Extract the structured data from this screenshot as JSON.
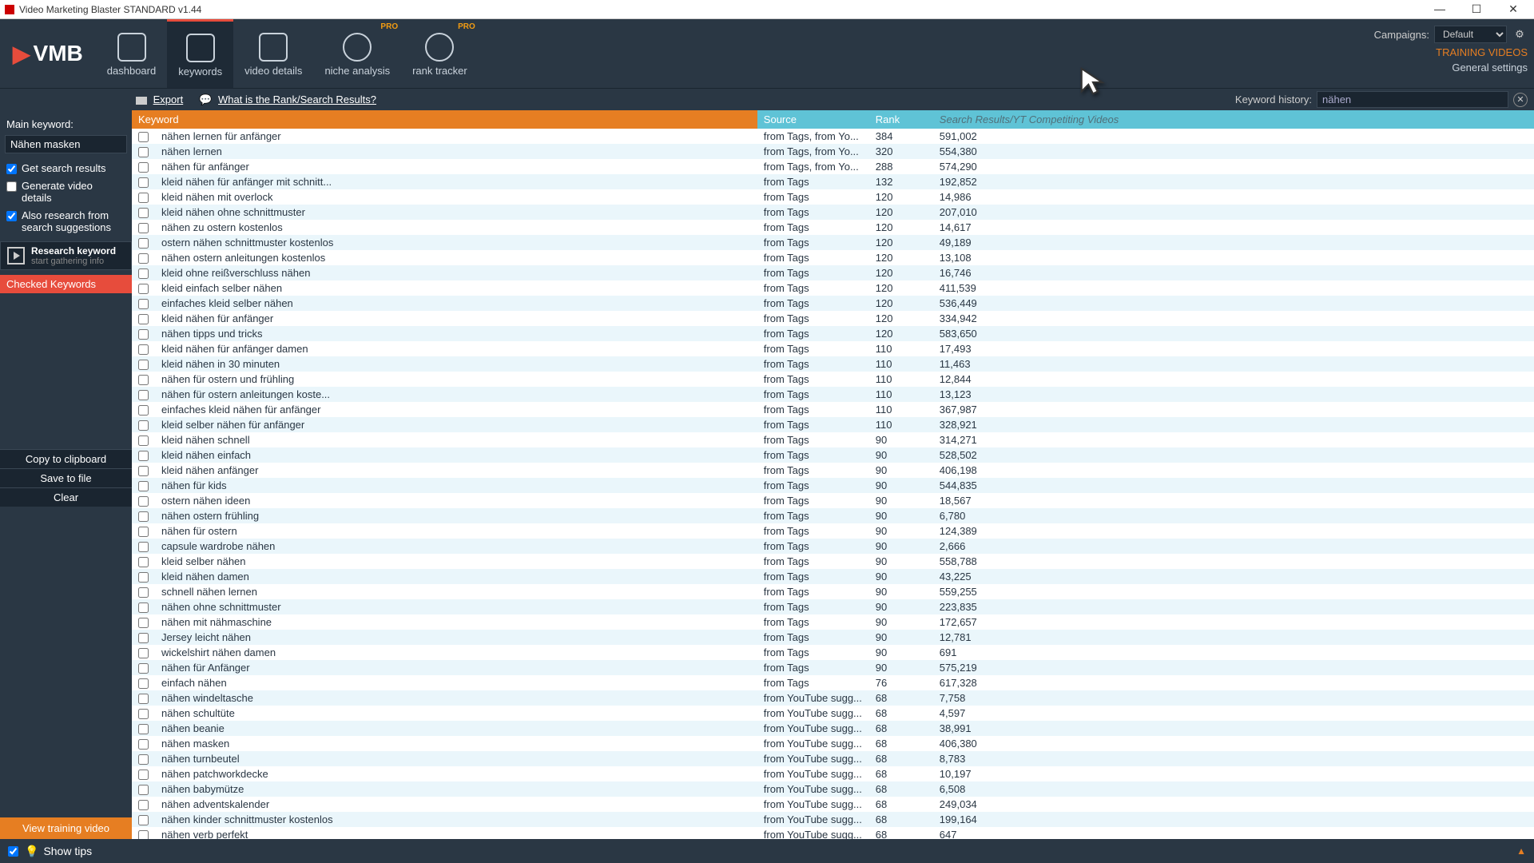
{
  "window": {
    "title": "Video Marketing Blaster STANDARD v1.44"
  },
  "logo": {
    "brand": "VMB"
  },
  "nav": {
    "tabs": [
      {
        "label": "dashboard"
      },
      {
        "label": "keywords"
      },
      {
        "label": "video details"
      },
      {
        "label": "niche analysis",
        "pro": "PRO"
      },
      {
        "label": "rank tracker",
        "pro": "PRO"
      }
    ]
  },
  "header_right": {
    "campaigns_label": "Campaigns:",
    "campaigns_value": "Default",
    "training": "TRAINING VIDEOS",
    "settings": "General settings"
  },
  "toolbar": {
    "export": "Export",
    "help": "What is the Rank/Search Results?",
    "history_label": "Keyword history:",
    "history_value": "nähen"
  },
  "sidebar": {
    "main_kw_label": "Main keyword:",
    "main_kw_value": "Nähen masken",
    "get_search": "Get search results",
    "gen_details": "Generate video details",
    "also_research": "Also research from search suggestions",
    "research_t1": "Research keyword",
    "research_t2": "start gathering info",
    "checked": "Checked Keywords",
    "copy": "Copy to clipboard",
    "save": "Save to file",
    "clear": "Clear",
    "view_training": "View training video"
  },
  "columns": {
    "keyword": "Keyword",
    "source": "Source",
    "rank": "Rank",
    "results": "Search Results/YT Competiting Videos"
  },
  "rows": [
    {
      "kw": "nähen lernen für anfänger",
      "src": "from Tags, from Yo...",
      "rank": "384",
      "res": "591,002"
    },
    {
      "kw": "nähen lernen",
      "src": "from Tags, from Yo...",
      "rank": "320",
      "res": "554,380"
    },
    {
      "kw": "nähen für anfänger",
      "src": "from Tags, from Yo...",
      "rank": "288",
      "res": "574,290"
    },
    {
      "kw": "kleid nähen für anfänger mit schnitt...",
      "src": "from Tags",
      "rank": "132",
      "res": "192,852"
    },
    {
      "kw": "kleid nähen mit overlock",
      "src": "from Tags",
      "rank": "120",
      "res": "14,986"
    },
    {
      "kw": "kleid nähen ohne schnittmuster",
      "src": "from Tags",
      "rank": "120",
      "res": "207,010"
    },
    {
      "kw": "nähen zu ostern kostenlos",
      "src": "from Tags",
      "rank": "120",
      "res": "14,617"
    },
    {
      "kw": "ostern nähen schnittmuster kostenlos",
      "src": "from Tags",
      "rank": "120",
      "res": "49,189"
    },
    {
      "kw": "nähen ostern anleitungen kostenlos",
      "src": "from Tags",
      "rank": "120",
      "res": "13,108"
    },
    {
      "kw": "kleid ohne reißverschluss nähen",
      "src": "from Tags",
      "rank": "120",
      "res": "16,746"
    },
    {
      "kw": "kleid einfach selber nähen",
      "src": "from Tags",
      "rank": "120",
      "res": "411,539"
    },
    {
      "kw": "einfaches kleid selber nähen",
      "src": "from Tags",
      "rank": "120",
      "res": "536,449"
    },
    {
      "kw": "kleid nähen für anfänger",
      "src": "from Tags",
      "rank": "120",
      "res": "334,942"
    },
    {
      "kw": "nähen tipps und tricks",
      "src": "from Tags",
      "rank": "120",
      "res": "583,650"
    },
    {
      "kw": "kleid nähen für anfänger damen",
      "src": "from Tags",
      "rank": "110",
      "res": "17,493"
    },
    {
      "kw": "kleid nähen in 30 minuten",
      "src": "from Tags",
      "rank": "110",
      "res": "11,463"
    },
    {
      "kw": "nähen für ostern und frühling",
      "src": "from Tags",
      "rank": "110",
      "res": "12,844"
    },
    {
      "kw": "nähen für ostern anleitungen koste...",
      "src": "from Tags",
      "rank": "110",
      "res": "13,123"
    },
    {
      "kw": "einfaches kleid nähen für anfänger",
      "src": "from Tags",
      "rank": "110",
      "res": "367,987"
    },
    {
      "kw": "kleid selber nähen für anfänger",
      "src": "from Tags",
      "rank": "110",
      "res": "328,921"
    },
    {
      "kw": "kleid nähen schnell",
      "src": "from Tags",
      "rank": "90",
      "res": "314,271"
    },
    {
      "kw": "kleid nähen einfach",
      "src": "from Tags",
      "rank": "90",
      "res": "528,502"
    },
    {
      "kw": "kleid nähen anfänger",
      "src": "from Tags",
      "rank": "90",
      "res": "406,198"
    },
    {
      "kw": "nähen für kids",
      "src": "from Tags",
      "rank": "90",
      "res": "544,835"
    },
    {
      "kw": "ostern nähen ideen",
      "src": "from Tags",
      "rank": "90",
      "res": "18,567"
    },
    {
      "kw": "nähen ostern frühling",
      "src": "from Tags",
      "rank": "90",
      "res": "6,780"
    },
    {
      "kw": "nähen für ostern",
      "src": "from Tags",
      "rank": "90",
      "res": "124,389"
    },
    {
      "kw": "capsule wardrobe nähen",
      "src": "from Tags",
      "rank": "90",
      "res": "2,666"
    },
    {
      "kw": "kleid selber nähen",
      "src": "from Tags",
      "rank": "90",
      "res": "558,788"
    },
    {
      "kw": "kleid nähen damen",
      "src": "from Tags",
      "rank": "90",
      "res": "43,225"
    },
    {
      "kw": "schnell nähen lernen",
      "src": "from Tags",
      "rank": "90",
      "res": "559,255"
    },
    {
      "kw": "nähen ohne schnittmuster",
      "src": "from Tags",
      "rank": "90",
      "res": "223,835"
    },
    {
      "kw": "nähen mit nähmaschine",
      "src": "from Tags",
      "rank": "90",
      "res": "172,657"
    },
    {
      "kw": "Jersey leicht nähen",
      "src": "from Tags",
      "rank": "90",
      "res": "12,781"
    },
    {
      "kw": "wickelshirt nähen damen",
      "src": "from Tags",
      "rank": "90",
      "res": "691"
    },
    {
      "kw": "nähen für Anfänger",
      "src": "from Tags",
      "rank": "90",
      "res": "575,219"
    },
    {
      "kw": "einfach nähen",
      "src": "from Tags",
      "rank": "76",
      "res": "617,328"
    },
    {
      "kw": "nähen windeltasche",
      "src": "from YouTube sugg...",
      "rank": "68",
      "res": "7,758"
    },
    {
      "kw": "nähen schultüte",
      "src": "from YouTube sugg...",
      "rank": "68",
      "res": "4,597"
    },
    {
      "kw": "nähen beanie",
      "src": "from YouTube sugg...",
      "rank": "68",
      "res": "38,991"
    },
    {
      "kw": "nähen masken",
      "src": "from YouTube sugg...",
      "rank": "68",
      "res": "406,380"
    },
    {
      "kw": "nähen turnbeutel",
      "src": "from YouTube sugg...",
      "rank": "68",
      "res": "8,783"
    },
    {
      "kw": "nähen patchworkdecke",
      "src": "from YouTube sugg...",
      "rank": "68",
      "res": "10,197"
    },
    {
      "kw": "nähen babymütze",
      "src": "from YouTube sugg...",
      "rank": "68",
      "res": "6,508"
    },
    {
      "kw": "nähen adventskalender",
      "src": "from YouTube sugg...",
      "rank": "68",
      "res": "249,034"
    },
    {
      "kw": "nähen kinder schnittmuster kostenlos",
      "src": "from YouTube sugg...",
      "rank": "68",
      "res": "199,164"
    },
    {
      "kw": "nähen verb perfekt",
      "src": "from YouTube sugg...",
      "rank": "68",
      "res": "647"
    }
  ],
  "footer": {
    "tips": "Show tips"
  }
}
